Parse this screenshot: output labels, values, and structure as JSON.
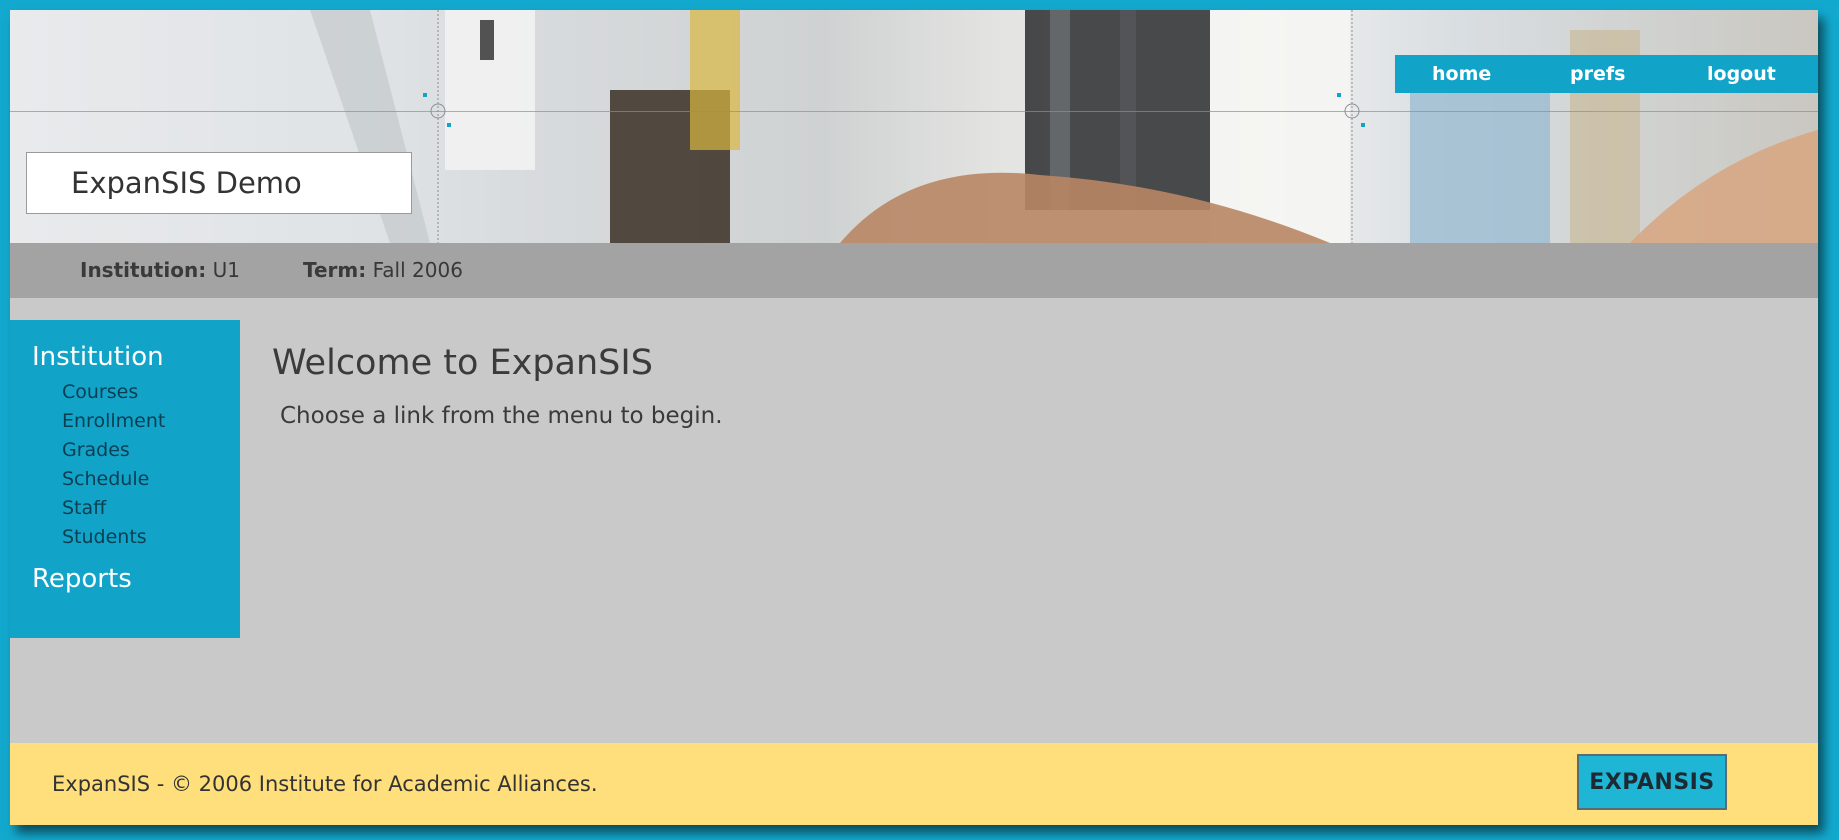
{
  "header": {
    "site_title": "ExpanSIS Demo",
    "nav": {
      "home": "home",
      "prefs": "prefs",
      "logout": "logout"
    }
  },
  "infobar": {
    "institution_label": "Institution:",
    "institution_value": "U1",
    "term_label": "Term:",
    "term_value": "Fall 2006"
  },
  "sidebar": {
    "section_institution": "Institution",
    "items": [
      "Courses",
      "Enrollment",
      "Grades",
      "Schedule",
      "Staff",
      "Students"
    ],
    "section_reports": "Reports"
  },
  "main": {
    "title": "Welcome to ExpanSIS",
    "subtitle": "Choose a link from the menu to begin."
  },
  "footer": {
    "copyright": "ExpanSIS - © 2006 Institute for Academic Alliances.",
    "logo_text": "EXPANSIS"
  },
  "colors": {
    "accent": "#12a3c9",
    "page_bg": "#13a9cf",
    "content_bg": "#c9c9c9",
    "infobar_bg": "#a3a3a3",
    "footer_bg": "#fedf7c"
  }
}
